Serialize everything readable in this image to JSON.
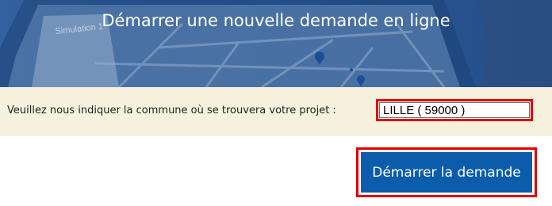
{
  "banner": {
    "title": "Démarrer une nouvelle demande en ligne",
    "image": {
      "label": "Simulation 1",
      "pin_icon": "map-pin-icon"
    }
  },
  "form": {
    "commune_label": "Veuillez nous indiquer la commune où se trouvera votre projet :",
    "commune_value": "LILLE ( 59000 )"
  },
  "actions": {
    "start_label": "Démarrer la demande"
  },
  "colors": {
    "banner_blue": "#2c5f9e",
    "form_background": "#f6f1dc",
    "button_blue": "#0b5cab",
    "highlight_red": "#e00000"
  }
}
